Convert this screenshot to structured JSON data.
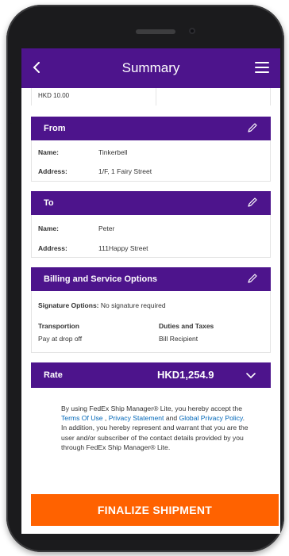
{
  "header": {
    "title": "Summary"
  },
  "previous": {
    "value": "HKD 10.00"
  },
  "from": {
    "heading": "From",
    "name_label": "Name:",
    "name": "Tinkerbell",
    "address_label": "Address:",
    "address": "1/F, 1 Fairy Street"
  },
  "to": {
    "heading": "To",
    "name_label": "Name:",
    "name": "Peter",
    "address_label": "Address:",
    "address": "111Happy Street"
  },
  "billing": {
    "heading": "Billing and Service Options",
    "signature_label": "Signature Options:",
    "signature_value": "No signature required",
    "transportation_label": "Transportion",
    "transportation_value": "Pay at drop off",
    "duties_label": "Duties and Taxes",
    "duties_value": "Bill Recipient"
  },
  "rate": {
    "label": "Rate",
    "amount": "HKD1,254.9"
  },
  "terms": {
    "t1": "By using FedEx Ship Manager® Lite, you hereby accept the ",
    "link_terms": "Terms Of Use",
    "t2": " , ",
    "link_privacy": "Privacy Statement",
    "t3": " and ",
    "link_global": "Global Privacy Policy",
    "t4": ". In addition, you hereby represent and warrant that you are the user and/or subscriber of the contact details provided by you through FedEx Ship Manager® Lite."
  },
  "actions": {
    "finalize_label": "FINALIZE SHIPMENT"
  },
  "colors": {
    "purple": "#4d148c",
    "orange": "#ff6200",
    "link": "#0067b8"
  }
}
